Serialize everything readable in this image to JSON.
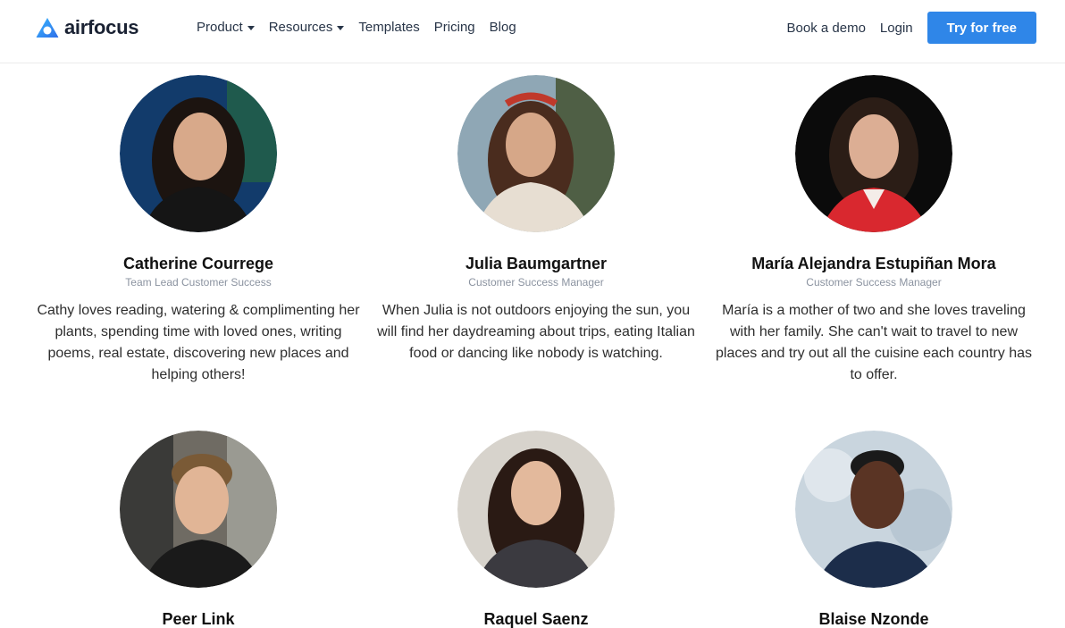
{
  "header": {
    "logo_text": "airfocus",
    "nav": [
      {
        "label": "Product",
        "dropdown": true
      },
      {
        "label": "Resources",
        "dropdown": true
      },
      {
        "label": "Templates",
        "dropdown": false
      },
      {
        "label": "Pricing",
        "dropdown": false
      },
      {
        "label": "Blog",
        "dropdown": false
      }
    ],
    "book_demo": "Book a demo",
    "login": "Login",
    "cta": "Try for free"
  },
  "colors": {
    "accent": "#2f86e8",
    "text": "#1b1b1b",
    "muted": "#8b93a0"
  },
  "team": [
    {
      "name": "Catherine Courrege",
      "role": "Team Lead Customer Success",
      "bio": "Cathy loves reading, watering & complimenting her plants, spending time with loved ones, writing poems, real estate, discovering new places and helping others!"
    },
    {
      "name": "Julia Baumgartner",
      "role": "Customer Success Manager",
      "bio": "When Julia is not outdoors enjoying the sun, you will find her daydreaming about trips, eating Italian food or dancing like nobody is watching."
    },
    {
      "name": "María Alejandra Estupiñan Mora",
      "role": "Customer Success Manager",
      "bio": "María is a mother of two and she loves traveling with her family. She can't wait to travel to new places and try out all the cuisine each country has to offer."
    },
    {
      "name": "Peer Link"
    },
    {
      "name": "Raquel Saenz"
    },
    {
      "name": "Blaise Nzonde"
    }
  ]
}
